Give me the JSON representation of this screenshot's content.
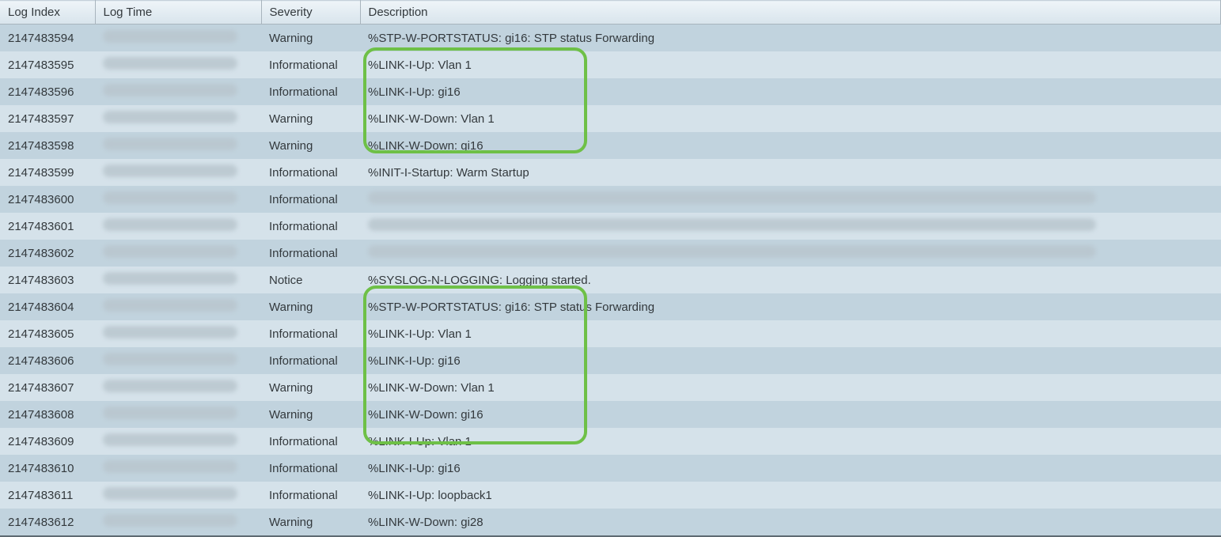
{
  "headers": {
    "index": "Log Index",
    "time": "Log Time",
    "severity": "Severity",
    "description": "Description"
  },
  "rows": [
    {
      "index": "2147483594",
      "severity": "Warning",
      "description": "%STP-W-PORTSTATUS: gi16: STP status Forwarding",
      "timeRedacted": true
    },
    {
      "index": "2147483595",
      "severity": "Informational",
      "description": "%LINK-I-Up:  Vlan 1",
      "timeRedacted": true
    },
    {
      "index": "2147483596",
      "severity": "Informational",
      "description": "%LINK-I-Up:  gi16",
      "timeRedacted": true
    },
    {
      "index": "2147483597",
      "severity": "Warning",
      "description": "%LINK-W-Down:  Vlan 1",
      "timeRedacted": true
    },
    {
      "index": "2147483598",
      "severity": "Warning",
      "description": "%LINK-W-Down:  gi16",
      "timeRedacted": true
    },
    {
      "index": "2147483599",
      "severity": "Informational",
      "description": "%INIT-I-Startup: Warm Startup",
      "timeRedacted": true
    },
    {
      "index": "2147483600",
      "severity": "Informational",
      "descRedacted": true,
      "timeRedacted": true
    },
    {
      "index": "2147483601",
      "severity": "Informational",
      "descRedacted": true,
      "timeRedacted": true
    },
    {
      "index": "2147483602",
      "severity": "Informational",
      "descRedacted": true,
      "timeRedacted": true
    },
    {
      "index": "2147483603",
      "severity": "Notice",
      "description": "%SYSLOG-N-LOGGING: Logging started.",
      "timeRedacted": true
    },
    {
      "index": "2147483604",
      "severity": "Warning",
      "description": "%STP-W-PORTSTATUS: gi16: STP status Forwarding",
      "timeRedacted": true
    },
    {
      "index": "2147483605",
      "severity": "Informational",
      "description": "%LINK-I-Up:  Vlan 1",
      "timeRedacted": true
    },
    {
      "index": "2147483606",
      "severity": "Informational",
      "description": "%LINK-I-Up:  gi16",
      "timeRedacted": true
    },
    {
      "index": "2147483607",
      "severity": "Warning",
      "description": "%LINK-W-Down:  Vlan 1",
      "timeRedacted": true
    },
    {
      "index": "2147483608",
      "severity": "Warning",
      "description": "%LINK-W-Down:  gi16",
      "timeRedacted": true
    },
    {
      "index": "2147483609",
      "severity": "Informational",
      "description": "%LINK-I-Up:  Vlan 1",
      "timeRedacted": true
    },
    {
      "index": "2147483610",
      "severity": "Informational",
      "description": "%LINK-I-Up:  gi16",
      "timeRedacted": true
    },
    {
      "index": "2147483611",
      "severity": "Informational",
      "description": "%LINK-I-Up:  loopback1",
      "timeRedacted": true
    },
    {
      "index": "2147483612",
      "severity": "Warning",
      "description": "%LINK-W-Down:  gi28",
      "timeRedacted": true
    }
  ]
}
